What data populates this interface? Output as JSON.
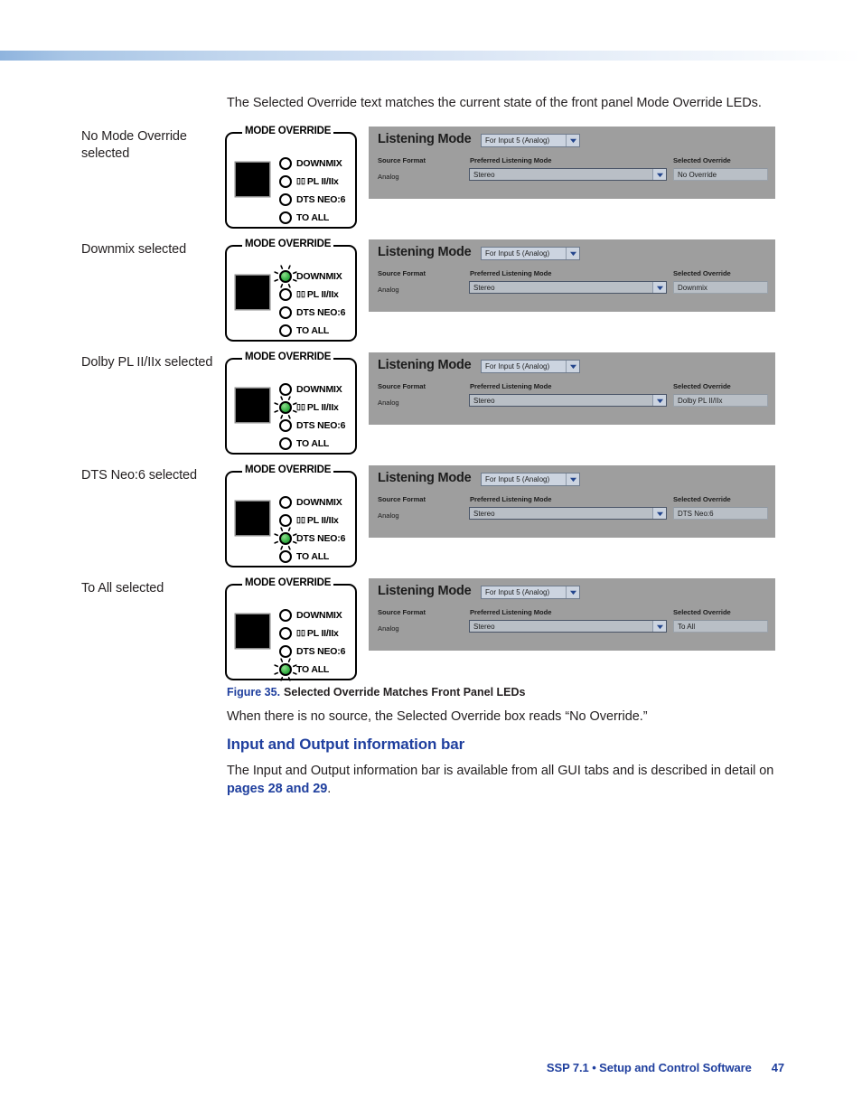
{
  "intro": {
    "text": "The Selected Override text matches the current state of the front panel Mode Override LEDs."
  },
  "panel": {
    "title": "MODE OVERRIDE",
    "leds": [
      "DOWNMIX",
      "PL II/IIx",
      "DTS NEO:6",
      "TO ALL"
    ],
    "dolby_symbol": "▯▯"
  },
  "gui": {
    "title": "Listening Mode",
    "input_select_value": "For Input 5 (Analog)",
    "col_source_format": "Source Format",
    "col_preferred": "Preferred Listening Mode",
    "col_selected_override": "Selected Override",
    "source_format_value": "Analog",
    "preferred_value": "Stereo"
  },
  "rows": [
    {
      "label": "No Mode Override selected",
      "lit_index": -1,
      "override_value": "No Override"
    },
    {
      "label": "Downmix selected",
      "lit_index": 0,
      "override_value": "Downmix"
    },
    {
      "label": "Dolby PL II/IIx selected",
      "lit_index": 1,
      "override_value": "Dolby PL II/IIx"
    },
    {
      "label": "DTS Neo:6 selected",
      "lit_index": 2,
      "override_value": "DTS Neo:6"
    },
    {
      "label": "To All selected",
      "lit_index": 3,
      "override_value": "To All"
    }
  ],
  "caption": {
    "figure_number": "Figure 35.",
    "figure_title": "Selected Override Matches Front Panel LEDs"
  },
  "body": {
    "no_source_note": "When there is no source, the Selected Override box reads “No Override.”",
    "section_heading": "Input and Output information bar",
    "io_bar_text_1": "The Input and Output information bar is available from all GUI tabs and is described in detail on ",
    "io_bar_link": "pages 28 and 29",
    "io_bar_text_2": "."
  },
  "footer": {
    "text": "SSP 7.1 • Setup and Control Software",
    "page": "47"
  },
  "colors": {
    "accent_blue": "#1f3f9e",
    "led_green": "#3cb54a",
    "gui_gray": "#9e9e9e",
    "field_gray": "#b9bfc6"
  }
}
